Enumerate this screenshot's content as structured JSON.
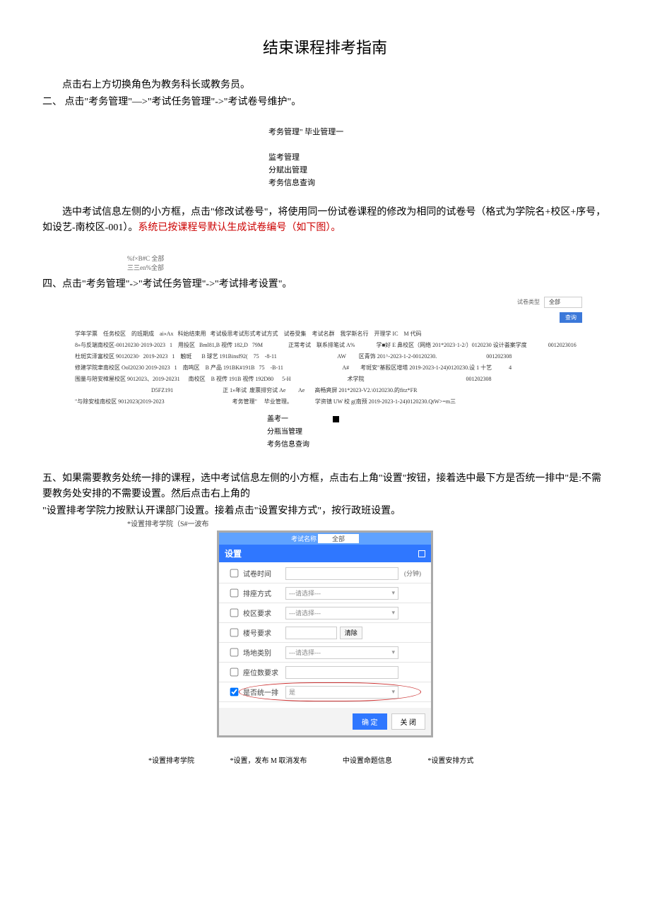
{
  "title": "结束课程排考指南",
  "p1": "点击右上方切换角色为教务科长或教务员。",
  "p2": "二、 点击\"考务管理\"—>\"考试任务管理\"->\"考试卷号维护\"。",
  "menu1": {
    "top": "考务管理\"   毕业管理一",
    "items": [
      "监考管理",
      "分赋出管理",
      "考务信息查询"
    ]
  },
  "p3a": "选中考试信息左侧的小方框，点击\"修改试卷号\"，将使用同一份试卷课程的修改为相同的试卷号（格式为学院名+校区+序号，如设艺-南校区-001）。",
  "p3b": "系统已按课程号默认生成试卷编号（如下图）。",
  "tiny_group": [
    "%f×B#C 全部",
    "三三en%全部"
  ],
  "p4": "四、点击\"考务管理\"->\"考试任务管理\"->\"考试排考设置\"。",
  "filter": {
    "label": "试卷类型",
    "value": "全部",
    "btn": "查询"
  },
  "headers": "学年学票    任务校区    的班期成    ai»Ax   科始结束用   考试极思考试形式考试方式    试卷受集    考试名群    我学斯名行    开理学 IC    M 代码",
  "data_rows": [
    "8»与反端南校区-00120230·2019-2023   1    用投区   Bml81,B 视传 182,D   79M                  正常考试    联系排笔试 A%               学■好 E 鼻校区（网络 201*2023·1-2/）0120230 设计荟案学度               0012023016",
    "杜斑实泽富校区 90120230·  2019-2023   1    触斑       B 球艺 191Binsf92(    75    -8-11                                           AW         区青饰 201^-2023-1-2-00120230.                                   001202308",
    "修建学院聿南校区 Ool20230 2019-2023   1    南鸣区    B 产品 191BK#191B   75    -B-11                                          A#        考斑安\"基殴区增塔 2019-2023-1-24)0120230.设 1 十艺            4",
    "围量与陪安樟屋校区 9012023、2019-20231      南校区    B 视传 191B 视传 192D80      5-H                                        术学院                                                                        001202308",
    "                                                      D5FZ191                                   正 1»年试  废票排穷试 Ae         Ae       高畅爽屏 201*2023-V2.\\0120230.的fitz*FR",
    "\"与除安桂南校区 9012023(2019-2023                                                考务管理\"     毕业管理。                学资镇 UW 校 g(南预 2019-2023-1-24)0120230.QtW>=m三"
  ],
  "menu2": {
    "items": [
      "盖考一",
      "分瓶当管理",
      "考务信息查询"
    ]
  },
  "p5": "五、如果需要教务处统一排的课程，选中考试信息左侧的小方框，点击右上角\"设置\"按钮，接着选中最下方是否统一排中\"是:不需要教务处安排的不需要设置。然后点击右上角的",
  "p6": "\"设置排考学院力按默认开课部门设置。接着点击\"设置安排方式\"，按行政班设置。",
  "dialog_outer": "*设置排考学院（S#一波布",
  "dialog": {
    "top_label": "考试名称",
    "top_value": "全部",
    "title": "设置",
    "rows": [
      {
        "label": "试卷时间",
        "type": "input",
        "unit": "(分钟)"
      },
      {
        "label": "排座方式",
        "type": "select",
        "placeholder": "---请选择---"
      },
      {
        "label": "校区要求",
        "type": "select",
        "placeholder": "---请选择---"
      },
      {
        "label": "楼号要求",
        "type": "input-btn",
        "btn": "清除"
      },
      {
        "label": "场地类别",
        "type": "select",
        "placeholder": "---请选择---"
      },
      {
        "label": "座位数要求",
        "type": "input",
        "unit": ""
      },
      {
        "label": "是否统一排",
        "type": "select-checked",
        "placeholder": "是"
      }
    ],
    "ok": "确 定",
    "cancel": "关 闭"
  },
  "actions": [
    "*设置排考学院",
    "*设置，发布 M 取消发布",
    "中设置命题信息",
    "*设置安排方式"
  ]
}
